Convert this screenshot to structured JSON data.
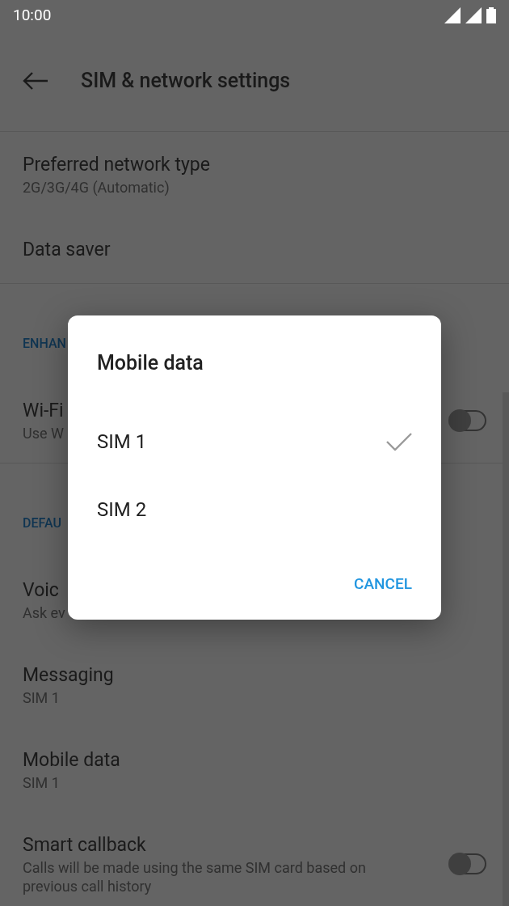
{
  "status_bar": {
    "time": "10:00"
  },
  "toolbar": {
    "title": "SIM & network settings"
  },
  "settings": [
    {
      "kind": "item",
      "title": "Preferred network type",
      "subtitle": "2G/3G/4G (Automatic)"
    },
    {
      "kind": "item",
      "title": "Data saver"
    },
    {
      "kind": "divider"
    },
    {
      "kind": "header",
      "title": "ENHAN"
    },
    {
      "kind": "toggle",
      "title": "Wi-Fi",
      "subtitle": "Use W",
      "on": false
    },
    {
      "kind": "divider"
    },
    {
      "kind": "header",
      "title": "DEFAU"
    },
    {
      "kind": "item",
      "title": "Voic",
      "subtitle": "Ask ev"
    },
    {
      "kind": "item",
      "title": "Messaging",
      "subtitle": "SIM 1"
    },
    {
      "kind": "item",
      "title": "Mobile data",
      "subtitle": "SIM 1"
    },
    {
      "kind": "toggle",
      "title": "Smart callback",
      "subtitle": "Calls will be made using the same SIM card based on previous call history",
      "on": false
    }
  ],
  "dialog": {
    "title": "Mobile data",
    "options": [
      {
        "label": "SIM 1",
        "selected": true
      },
      {
        "label": "SIM 2",
        "selected": false
      }
    ],
    "button": "CANCEL"
  }
}
